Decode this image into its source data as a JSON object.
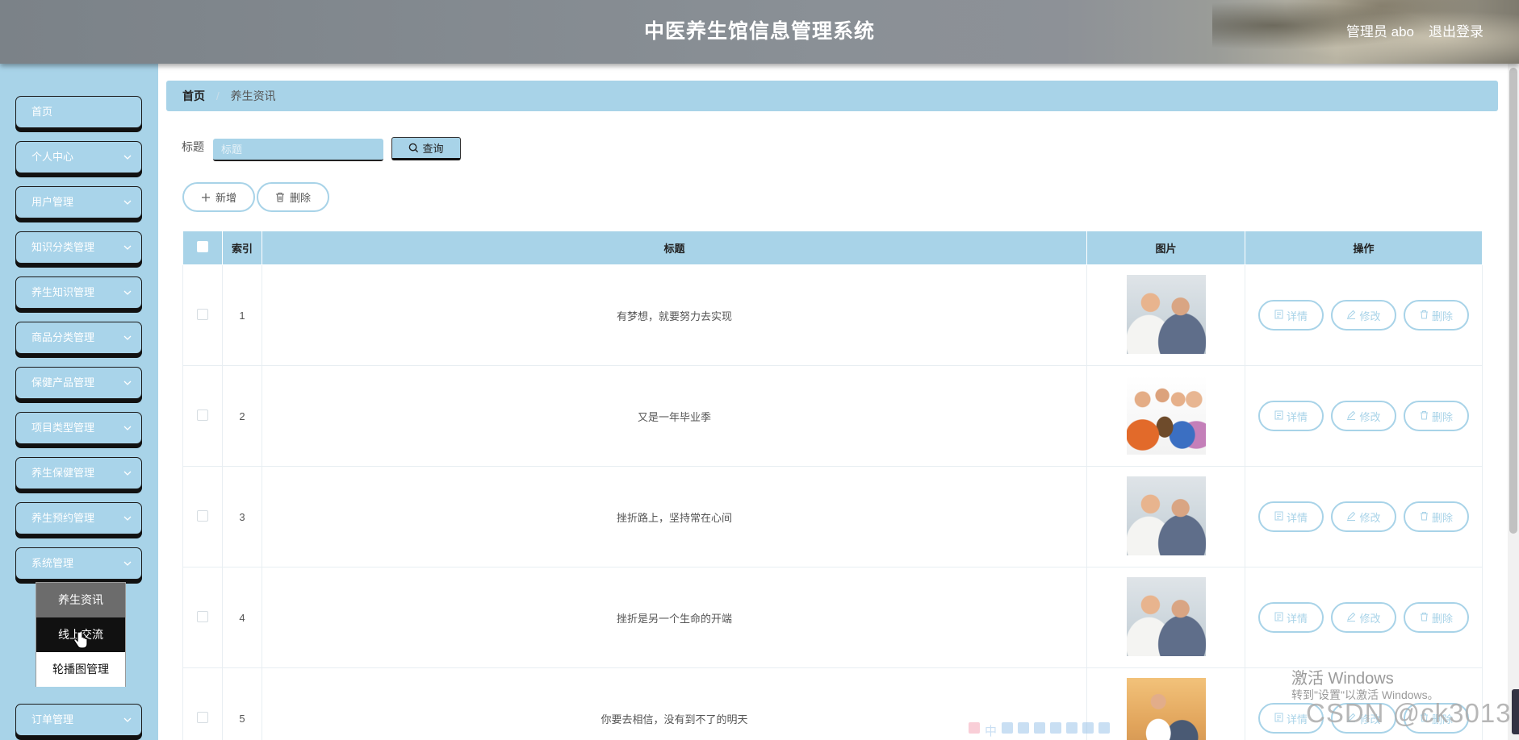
{
  "header": {
    "title": "中医养生馆信息管理系统",
    "user": "管理员 abo",
    "logout": "退出登录"
  },
  "sidebar": {
    "items": [
      {
        "label": "首页",
        "has_arrow": false
      },
      {
        "label": "个人中心",
        "has_arrow": true
      },
      {
        "label": "用户管理",
        "has_arrow": true
      },
      {
        "label": "知识分类管理",
        "has_arrow": true
      },
      {
        "label": "养生知识管理",
        "has_arrow": true
      },
      {
        "label": "商品分类管理",
        "has_arrow": true
      },
      {
        "label": "保健产品管理",
        "has_arrow": true
      },
      {
        "label": "项目类型管理",
        "has_arrow": true
      },
      {
        "label": "养生保健管理",
        "has_arrow": true
      },
      {
        "label": "养生预约管理",
        "has_arrow": true
      },
      {
        "label": "系统管理",
        "has_arrow": true
      },
      {
        "label": "订单管理",
        "has_arrow": true
      }
    ],
    "submenu": [
      "养生资讯",
      "线上交流",
      "轮播图管理"
    ]
  },
  "breadcrumb": {
    "home": "首页",
    "current": "养生资讯"
  },
  "search": {
    "label": "标题",
    "placeholder": "标题",
    "button": "查询"
  },
  "toolbar": {
    "add": "新增",
    "delete": "删除"
  },
  "table": {
    "columns": [
      "索引",
      "标题",
      "图片",
      "操作"
    ],
    "rows": [
      {
        "index": "1",
        "title": "有梦想，就要努力去实现",
        "image": "elderly-doctor-photo"
      },
      {
        "index": "2",
        "title": "又是一年毕业季",
        "image": "elderly-group-photo"
      },
      {
        "index": "3",
        "title": "挫折路上，坚持常在心间",
        "image": "elderly-doctor-photo"
      },
      {
        "index": "4",
        "title": "挫折是另一个生命的开端",
        "image": "elderly-doctor-photo"
      },
      {
        "index": "5",
        "title": "你要去相信，没有到不了的明天",
        "image": "nurse-care-photo"
      }
    ],
    "row_actions": {
      "detail": "详情",
      "edit": "修改",
      "delete": "删除"
    }
  },
  "overlays": {
    "windows_activate_title": "激活 Windows",
    "windows_activate_hint": "转到\"设置\"以激活 Windows。",
    "watermark": "CSDN @ck3013"
  },
  "colors": {
    "accent": "#a8d3e8",
    "header_bg": "#8a9096",
    "sidebar_bg": "#a8d3e8",
    "submenu_active_bg": "#6c6c6c",
    "submenu_hover_bg": "#111111"
  }
}
